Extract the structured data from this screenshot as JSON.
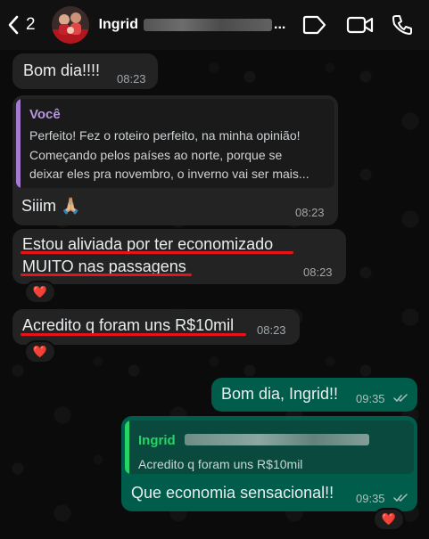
{
  "header": {
    "back_count": "2",
    "contact_name": "Ingrid",
    "name_ellipsis": "..."
  },
  "messages": [
    {
      "direction": "in",
      "text": "Bom dia!!!!",
      "time": "08:23"
    },
    {
      "direction": "in",
      "quote": {
        "author": "Você",
        "lines": [
          "Perfeito! Fez o roteiro perfeito, na minha opinião!",
          "Começando pelos países ao norte, porque se",
          "deixar eles pra novembro, o inverno vai ser mais..."
        ]
      },
      "text": "Siiim 🙏🏼",
      "time": "08:23"
    },
    {
      "direction": "in",
      "lines": [
        "Estou aliviada por ter economizado",
        "MUITO nas passagens"
      ],
      "time": "08:23",
      "reaction": "❤️"
    },
    {
      "direction": "in",
      "text": "Acredito q foram uns R$10mil",
      "time": "08:23",
      "reaction": "❤️"
    },
    {
      "direction": "out",
      "text": "Bom dia, Ingrid!!",
      "time": "09:35"
    },
    {
      "direction": "out",
      "quote": {
        "author": "Ingrid",
        "lines": [
          "Acredito q foram uns R$10mil"
        ]
      },
      "text": "Que economia sensacional!!",
      "time": "09:35",
      "reaction": "❤️"
    }
  ],
  "colors": {
    "incoming_bubble": "#232323",
    "outgoing_bubble": "#005c4b",
    "quote_you": "#a47bd0",
    "quote_ingrid": "#25d366",
    "annotation_underline": "#e6141a"
  },
  "icons": {
    "back": "chevron-left-icon",
    "label": "label-tag-icon",
    "video": "video-camera-icon",
    "call": "phone-icon",
    "read": "double-check-icon",
    "reaction": "heart"
  }
}
